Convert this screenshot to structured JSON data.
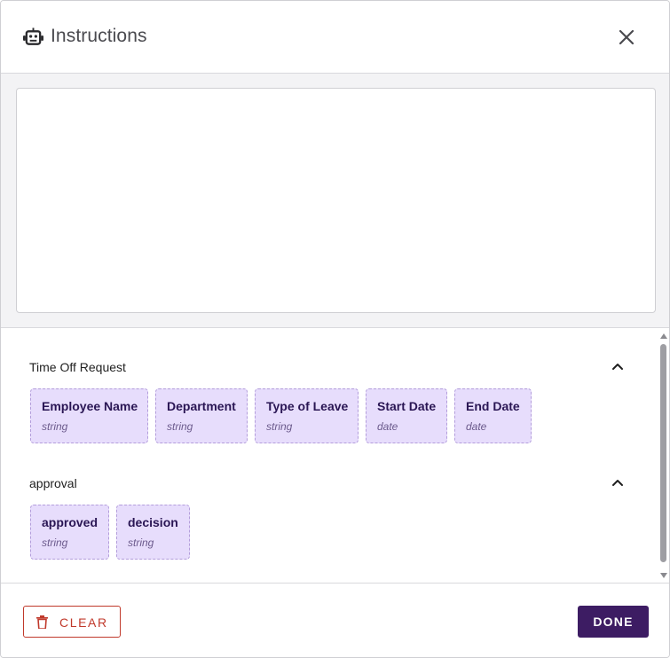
{
  "dialog": {
    "title": "Instructions",
    "title_icon": "robot-icon",
    "close_icon": "close-icon"
  },
  "editor": {
    "value": "",
    "placeholder": ""
  },
  "groups": [
    {
      "title": "Time Off Request",
      "expanded": true,
      "fields": [
        {
          "name": "Employee Name",
          "type": "string"
        },
        {
          "name": "Department",
          "type": "string"
        },
        {
          "name": "Type of Leave",
          "type": "string"
        },
        {
          "name": "Start Date",
          "type": "date"
        },
        {
          "name": "End Date",
          "type": "date"
        }
      ]
    },
    {
      "title": "approval",
      "expanded": true,
      "fields": [
        {
          "name": "approved",
          "type": "string"
        },
        {
          "name": "decision",
          "type": "string"
        }
      ]
    }
  ],
  "footer": {
    "clear_label": "CLEAR",
    "done_label": "DONE"
  },
  "colors": {
    "chip_bg": "#e7ddfc",
    "chip_border": "#b39ddb",
    "primary": "#3d1c63",
    "danger": "#c0392b"
  }
}
